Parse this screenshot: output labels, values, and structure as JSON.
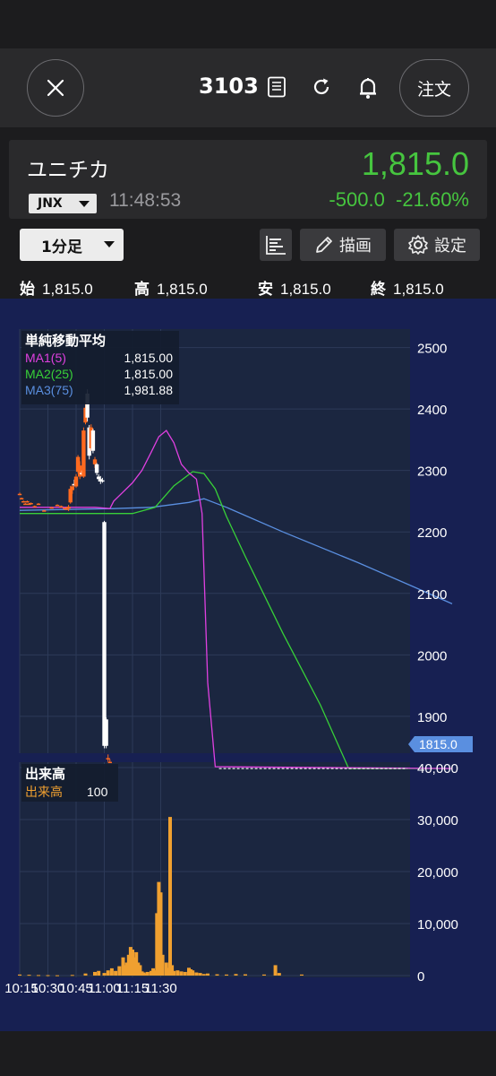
{
  "header": {
    "code": "3103",
    "order_label": "注文"
  },
  "quote": {
    "name": "ユニチカ",
    "price": "1,815.0",
    "market": "JNX",
    "time": "11:48:53",
    "change": "-500.0",
    "change_pct": "-21.60%",
    "up_color": "#46c53f"
  },
  "toolbar": {
    "timeframe": "1分足",
    "draw_label": "描画",
    "settings_label": "設定"
  },
  "ohlc": {
    "open_label": "始",
    "open": "1,815.0",
    "high_label": "高",
    "high": "1,815.0",
    "low_label": "安",
    "low": "1,815.0",
    "close_label": "終",
    "close": "1,815.0"
  },
  "ma_legend": {
    "title": "単純移動平均",
    "items": [
      {
        "name": "MA1(5)",
        "value": "1,815.00",
        "color": "#e040e0"
      },
      {
        "name": "MA2(25)",
        "value": "1,815.00",
        "color": "#38d038"
      },
      {
        "name": "MA3(75)",
        "value": "1,981.88",
        "color": "#5a8fe0"
      }
    ]
  },
  "vol_legend": {
    "title": "出来高",
    "name": "出来高",
    "value": "100",
    "color": "#f0a030"
  },
  "price_badge": "1815.0",
  "chart_data": [
    {
      "type": "candlestick",
      "ylim": [
        1840,
        2530
      ],
      "y_ticks": [
        "2500",
        "2400",
        "2300",
        "2200",
        "2100",
        "2000",
        "1900"
      ],
      "x_ticks": [
        "10:15",
        "10:30",
        "10:45",
        "11:00",
        "11:15",
        "11:30"
      ],
      "candles": [
        {
          "t": "10:15",
          "o": 2262,
          "h": 2264,
          "l": 2260,
          "c": 2262
        },
        {
          "t": "10:16",
          "o": 2255,
          "h": 2256,
          "l": 2253,
          "c": 2255
        },
        {
          "t": "10:17",
          "o": 2250,
          "h": 2251,
          "l": 2249,
          "c": 2250
        },
        {
          "t": "10:18",
          "o": 2246,
          "h": 2247,
          "l": 2245,
          "c": 2246
        },
        {
          "t": "10:19",
          "o": 2250,
          "h": 2251,
          "l": 2249,
          "c": 2250
        },
        {
          "t": "10:20",
          "o": 2246,
          "h": 2247,
          "l": 2245,
          "c": 2246
        },
        {
          "t": "10:21",
          "o": 2247,
          "h": 2248,
          "l": 2246,
          "c": 2247
        },
        {
          "t": "10:23",
          "o": 2242,
          "h": 2243,
          "l": 2241,
          "c": 2242
        },
        {
          "t": "10:25",
          "o": 2246,
          "h": 2247,
          "l": 2245,
          "c": 2246
        },
        {
          "t": "10:28",
          "o": 2235,
          "h": 2236,
          "l": 2234,
          "c": 2235
        },
        {
          "t": "10:32",
          "o": 2240,
          "h": 2241,
          "l": 2239,
          "c": 2240
        },
        {
          "t": "10:35",
          "o": 2244,
          "h": 2245,
          "l": 2243,
          "c": 2244
        },
        {
          "t": "10:37",
          "o": 2242,
          "h": 2243,
          "l": 2241,
          "c": 2242
        },
        {
          "t": "10:39",
          "o": 2239,
          "h": 2240,
          "l": 2238,
          "c": 2239
        },
        {
          "t": "10:40",
          "o": 2238,
          "h": 2240,
          "l": 2236,
          "c": 2238
        },
        {
          "t": "10:41",
          "o": 2238,
          "h": 2244,
          "l": 2234,
          "c": 2241
        },
        {
          "t": "10:42",
          "o": 2248,
          "h": 2275,
          "l": 2246,
          "c": 2270
        },
        {
          "t": "10:43",
          "o": 2268,
          "h": 2278,
          "l": 2262,
          "c": 2274
        },
        {
          "t": "10:44",
          "o": 2278,
          "h": 2285,
          "l": 2274,
          "c": 2276
        },
        {
          "t": "10:45",
          "o": 2274,
          "h": 2294,
          "l": 2272,
          "c": 2290
        },
        {
          "t": "10:46",
          "o": 2298,
          "h": 2325,
          "l": 2295,
          "c": 2322
        },
        {
          "t": "10:47",
          "o": 2290,
          "h": 2315,
          "l": 2286,
          "c": 2308
        },
        {
          "t": "10:48",
          "o": 2296,
          "h": 2300,
          "l": 2292,
          "c": 2294
        },
        {
          "t": "10:49",
          "o": 2290,
          "h": 2370,
          "l": 2288,
          "c": 2365
        },
        {
          "t": "10:50",
          "o": 2378,
          "h": 2408,
          "l": 2375,
          "c": 2402
        },
        {
          "t": "10:51",
          "o": 2425,
          "h": 2432,
          "l": 2380,
          "c": 2386
        },
        {
          "t": "10:52",
          "o": 2370,
          "h": 2374,
          "l": 2318,
          "c": 2324
        },
        {
          "t": "10:53",
          "o": 2336,
          "h": 2375,
          "l": 2332,
          "c": 2370
        },
        {
          "t": "10:54",
          "o": 2365,
          "h": 2368,
          "l": 2328,
          "c": 2332
        },
        {
          "t": "10:55",
          "o": 2310,
          "h": 2322,
          "l": 2304,
          "c": 2318
        },
        {
          "t": "10:56",
          "o": 2310,
          "h": 2312,
          "l": 2292,
          "c": 2296
        },
        {
          "t": "10:57",
          "o": 2290,
          "h": 2294,
          "l": 2282,
          "c": 2286
        },
        {
          "t": "10:58",
          "o": 2286,
          "h": 2291,
          "l": 2278,
          "c": 2282
        },
        {
          "t": "10:59",
          "o": 2284,
          "h": 2288,
          "l": 2280,
          "c": 2282
        },
        {
          "t": "11:00",
          "o": 2216,
          "h": 2218,
          "l": 1848,
          "c": 1852
        },
        {
          "t": "11:01",
          "o": 1895,
          "h": 1898,
          "l": 1848,
          "c": 1852
        },
        {
          "t": "11:02",
          "o": 1830,
          "h": 1838,
          "l": 1826,
          "c": 1832
        },
        {
          "t": "11:03",
          "o": 1826,
          "h": 1830,
          "l": 1824,
          "c": 1826
        }
      ],
      "ma1": [
        [
          0,
          2240
        ],
        [
          40,
          2240
        ],
        [
          48,
          2238
        ],
        [
          50,
          2250
        ],
        [
          55,
          2265
        ],
        [
          60,
          2280
        ],
        [
          65,
          2300
        ],
        [
          70,
          2330
        ],
        [
          74,
          2355
        ],
        [
          78,
          2365
        ],
        [
          82,
          2345
        ],
        [
          86,
          2310
        ],
        [
          90,
          2296
        ],
        [
          94,
          2286
        ],
        [
          97,
          2230
        ],
        [
          100,
          1955
        ],
        [
          104,
          1818
        ],
        [
          230,
          1815
        ]
      ],
      "ma2": [
        [
          0,
          2230
        ],
        [
          60,
          2230
        ],
        [
          72,
          2240
        ],
        [
          82,
          2275
        ],
        [
          92,
          2298
        ],
        [
          98,
          2295
        ],
        [
          104,
          2270
        ],
        [
          110,
          2225
        ],
        [
          120,
          2160
        ],
        [
          140,
          2035
        ],
        [
          160,
          1918
        ],
        [
          175,
          1815
        ],
        [
          230,
          1815
        ]
      ],
      "ma3": [
        [
          0,
          2235
        ],
        [
          50,
          2238
        ],
        [
          70,
          2240
        ],
        [
          90,
          2248
        ],
        [
          98,
          2254
        ],
        [
          110,
          2240
        ],
        [
          140,
          2200
        ],
        [
          180,
          2150
        ],
        [
          210,
          2110
        ],
        [
          230,
          2083
        ]
      ],
      "last_price": 1815.0
    },
    {
      "type": "bar",
      "name": "出来高",
      "ylim": [
        0,
        40000
      ],
      "y_ticks": [
        "40,000",
        "30,000",
        "20,000",
        "10,000",
        "0"
      ],
      "values": [
        [
          0,
          200
        ],
        [
          5,
          150
        ],
        [
          10,
          100
        ],
        [
          15,
          80
        ],
        [
          20,
          60
        ],
        [
          28,
          120
        ],
        [
          35,
          400
        ],
        [
          40,
          700
        ],
        [
          42,
          900
        ],
        [
          45,
          500
        ],
        [
          47,
          1000
        ],
        [
          49,
          1400
        ],
        [
          51,
          900
        ],
        [
          53,
          1800
        ],
        [
          55,
          3500
        ],
        [
          56,
          2000
        ],
        [
          57,
          2500
        ],
        [
          58,
          4000
        ],
        [
          59,
          5500
        ],
        [
          60,
          5000
        ],
        [
          61,
          3500
        ],
        [
          62,
          4500
        ],
        [
          63,
          2500
        ],
        [
          64,
          2000
        ],
        [
          65,
          800
        ],
        [
          66,
          600
        ],
        [
          67,
          400
        ],
        [
          68,
          700
        ],
        [
          70,
          900
        ],
        [
          71,
          1400
        ],
        [
          72,
          1000
        ],
        [
          73,
          12000
        ],
        [
          74,
          18000
        ],
        [
          75,
          16000
        ],
        [
          76,
          4000
        ],
        [
          78,
          2500
        ],
        [
          79,
          1500
        ],
        [
          80,
          30500
        ],
        [
          81,
          2000
        ],
        [
          82,
          900
        ],
        [
          84,
          1000
        ],
        [
          86,
          800
        ],
        [
          88,
          700
        ],
        [
          90,
          1500
        ],
        [
          91,
          1200
        ],
        [
          92,
          1000
        ],
        [
          94,
          600
        ],
        [
          96,
          500
        ],
        [
          98,
          300
        ],
        [
          100,
          400
        ],
        [
          105,
          250
        ],
        [
          110,
          200
        ],
        [
          115,
          300
        ],
        [
          120,
          250
        ],
        [
          130,
          200
        ],
        [
          136,
          2000
        ],
        [
          138,
          500
        ],
        [
          150,
          200
        ]
      ]
    }
  ]
}
